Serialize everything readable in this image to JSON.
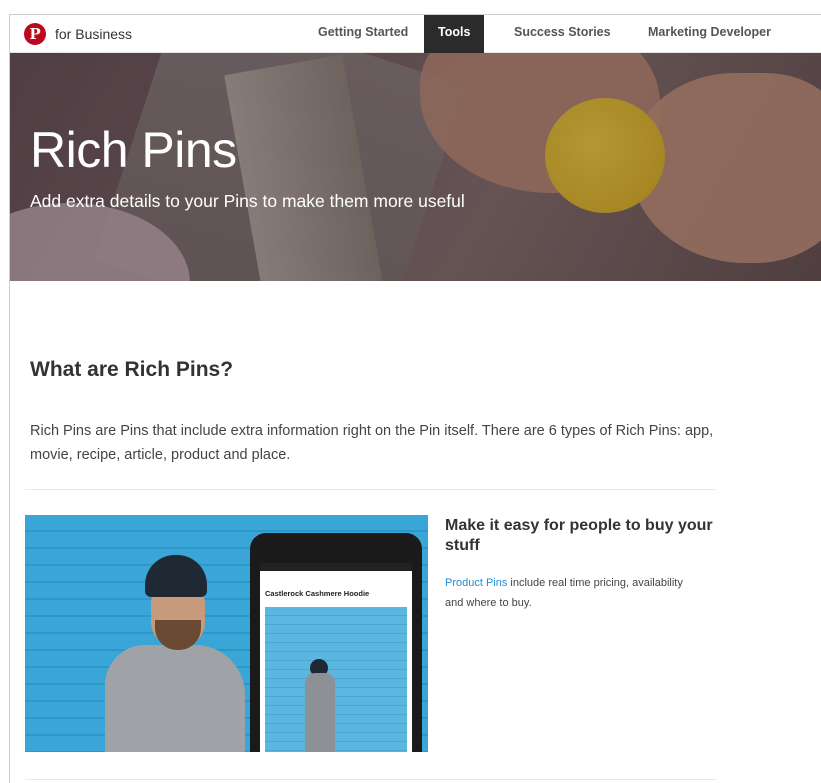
{
  "nav": {
    "brand": "for Business",
    "items": [
      {
        "label": "Getting Started",
        "active": false
      },
      {
        "label": "Tools",
        "active": true
      },
      {
        "label": "Success Stories",
        "active": false
      },
      {
        "label": "Marketing Developer Partners",
        "active": false
      }
    ]
  },
  "hero": {
    "title": "Rich Pins",
    "subtitle": "Add extra details to your Pins to make them more useful"
  },
  "section": {
    "title": "What are Rich Pins?",
    "intro": "Rich Pins are Pins that include extra information right on the Pin itself. There are 6 types of Rich Pins: app, movie, recipe, article, product and place."
  },
  "feature": {
    "title": "Make it easy for people to buy your stuff",
    "link": "Product Pins",
    "text": " include real time pricing, availability and where to buy.",
    "phone_pin_title": "Castlerock Cashmere Hoodie"
  },
  "colors": {
    "brand": "#bd081c",
    "link": "#1f8dd6",
    "nav_active_bg": "#2b2b2b"
  }
}
